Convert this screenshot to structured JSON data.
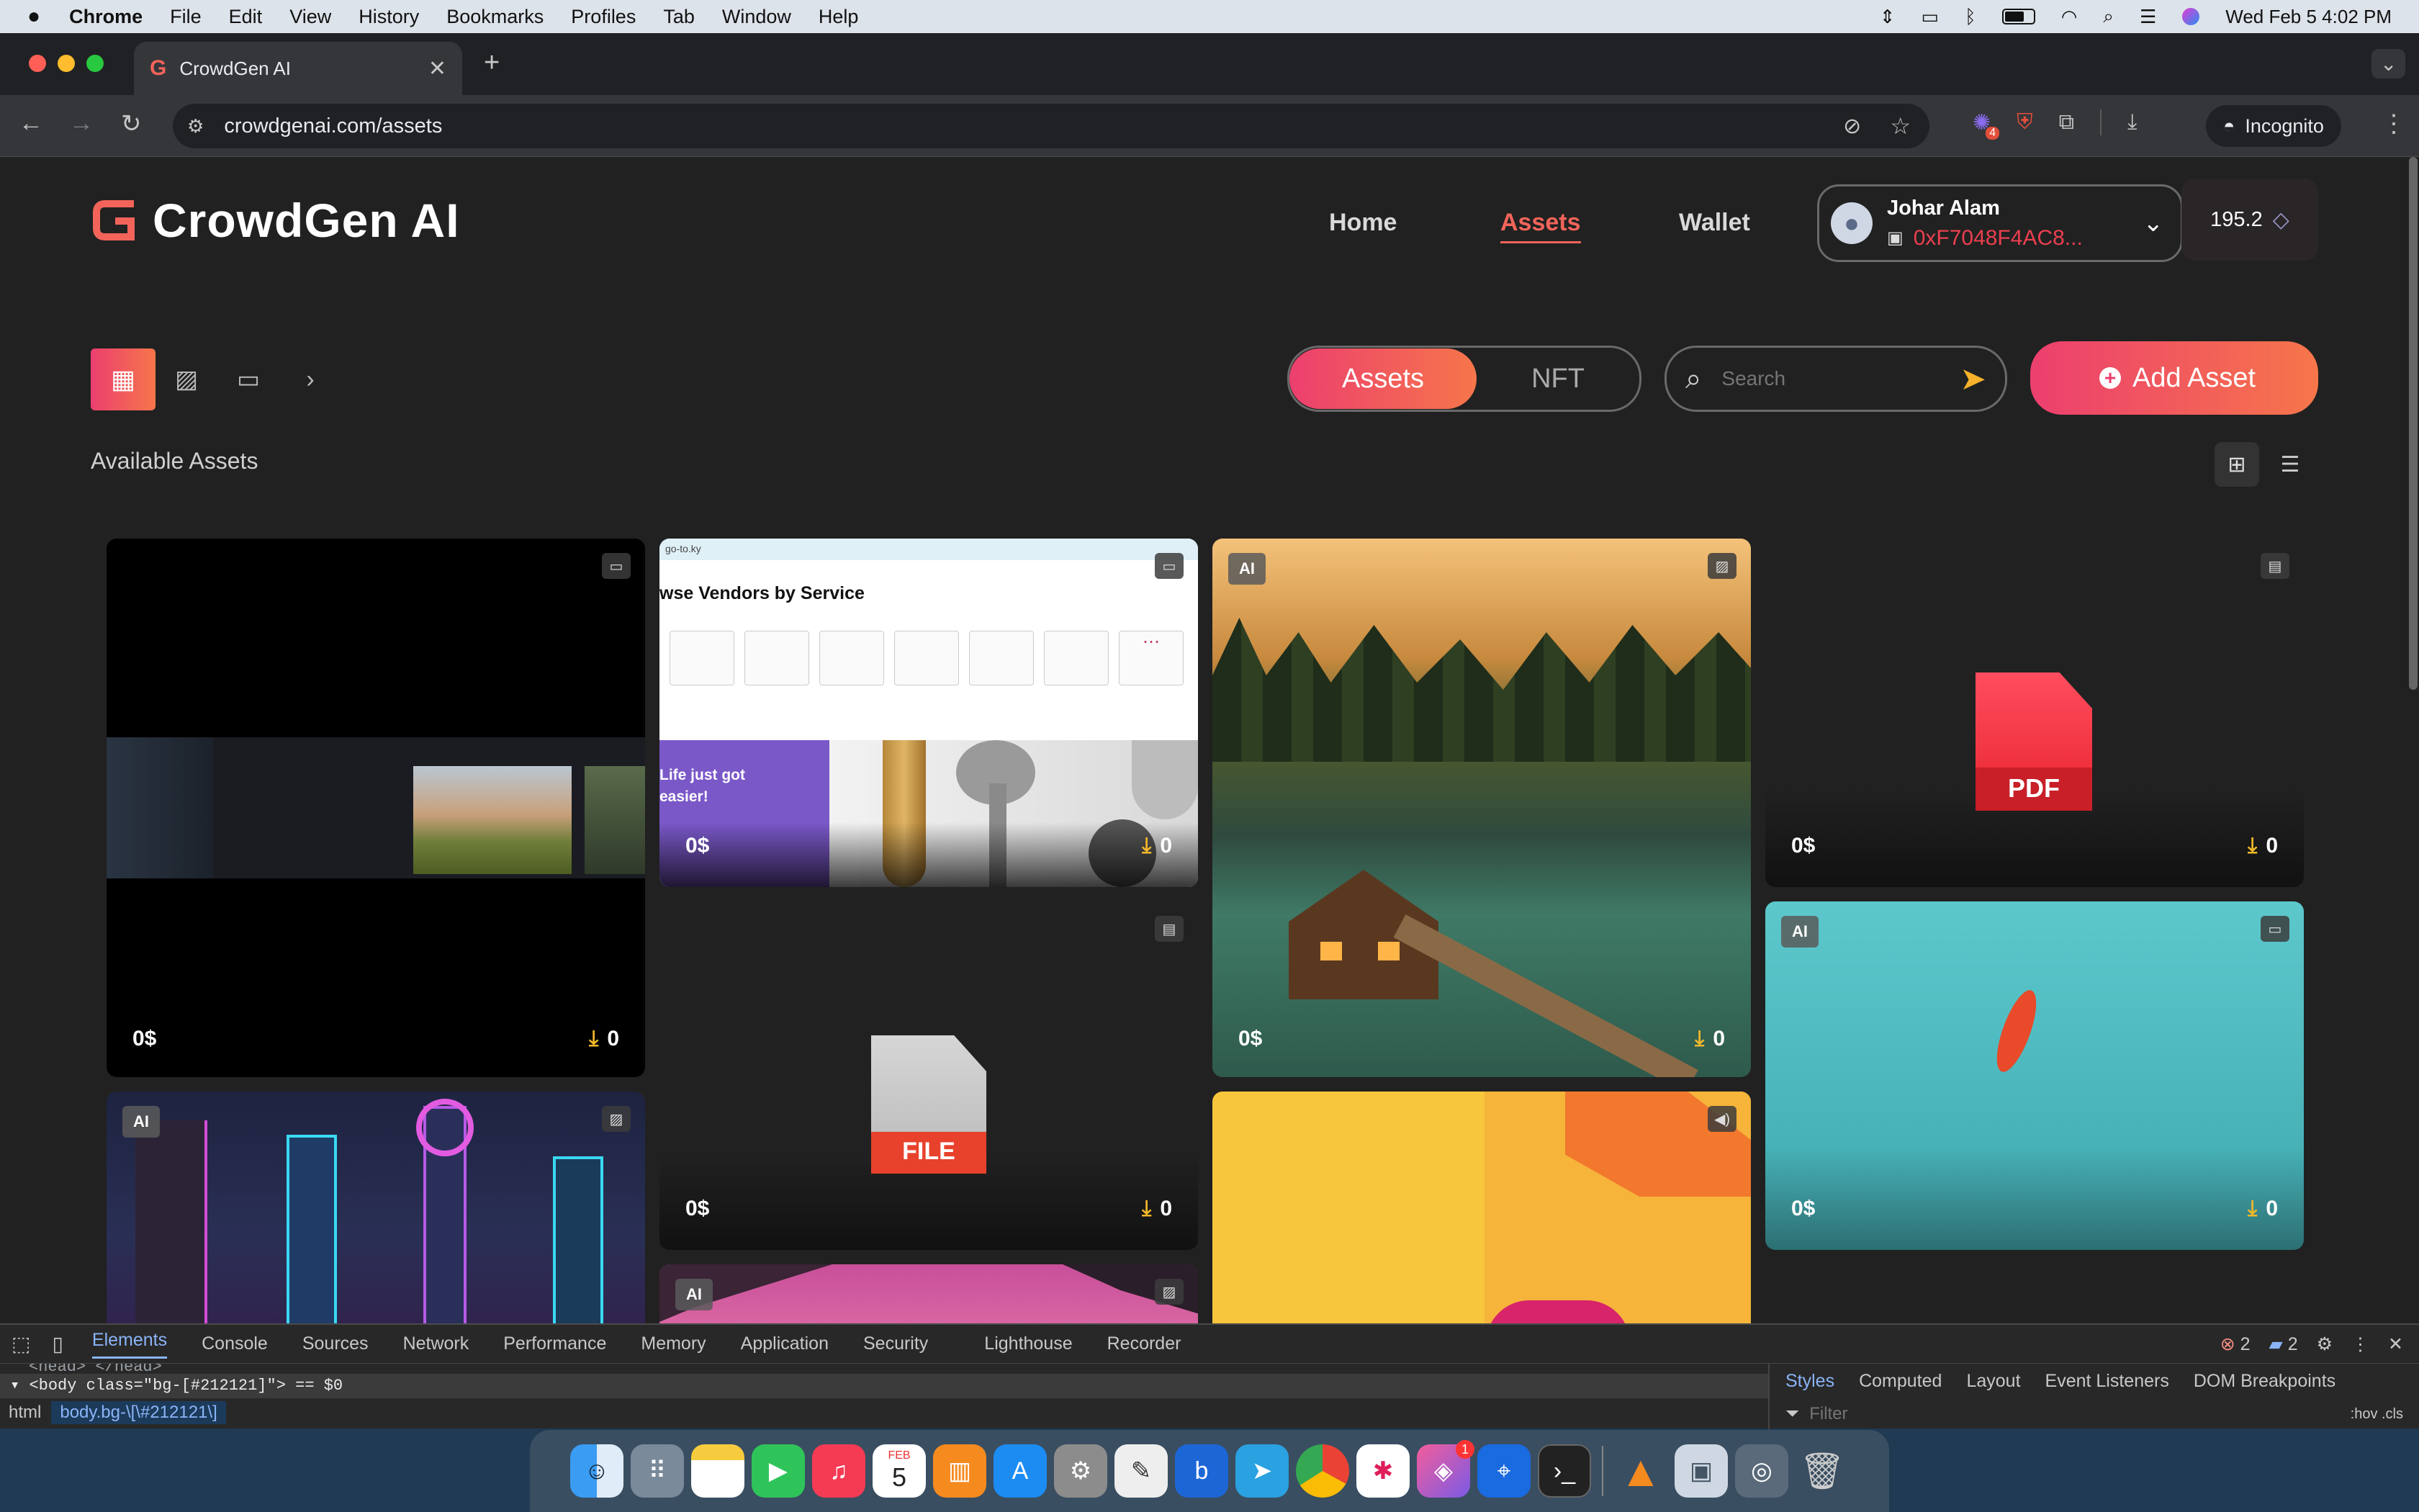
{
  "menubar": {
    "app": "Chrome",
    "items": [
      "File",
      "Edit",
      "View",
      "History",
      "Bookmarks",
      "Profiles",
      "Tab",
      "Window",
      "Help"
    ],
    "datetime": "Wed Feb 5  4:02 PM"
  },
  "browser": {
    "tab_title": "CrowdGen AI",
    "url": "crowdgenai.com/assets",
    "incognito_label": "Incognito",
    "extension_badge": "4"
  },
  "site": {
    "logo_text": "CrowdGen AI",
    "nav": [
      "Home",
      "Assets",
      "Wallet"
    ],
    "active_nav": "Assets",
    "user_name": "Johar Alam",
    "wallet_address": "0xF7048F4AC8...",
    "balance": "195.2"
  },
  "filters": {
    "toggle": [
      "Assets",
      "NFT"
    ],
    "search_placeholder": "Search",
    "add_label": "Add Asset",
    "section_title": "Available Assets"
  },
  "cards": [
    {
      "price": "0$",
      "downloads": "0",
      "type": "video",
      "ai": false
    },
    {
      "price": "0$",
      "downloads": "0",
      "type": "video",
      "ai": false,
      "heading": "wse Vendors by Service",
      "promo": "Life just got easier!",
      "mini_url": "go-to.ky"
    },
    {
      "price": "0$",
      "downloads": "0",
      "type": "image",
      "ai": true
    },
    {
      "price": "0$",
      "downloads": "0",
      "type": "document",
      "ai": false,
      "file_label": "PDF"
    },
    {
      "price": "0$",
      "downloads": "0",
      "type": "video",
      "ai": true
    },
    {
      "price": "0$",
      "downloads": "0",
      "type": "document",
      "ai": false,
      "file_label": "FILE"
    },
    {
      "price": "",
      "downloads": "",
      "type": "image",
      "ai": true
    },
    {
      "price": "",
      "downloads": "",
      "type": "image",
      "ai": true
    },
    {
      "price": "",
      "downloads": "",
      "type": "audio",
      "ai": false
    }
  ],
  "ai_badge": "AI",
  "devtools": {
    "tabs": [
      "Elements",
      "Console",
      "Sources",
      "Network",
      "Performance",
      "Memory",
      "Application",
      "Security",
      "Lighthouse",
      "Recorder"
    ],
    "errors": "2",
    "messages": "2",
    "dom_line": "<body class=\"bg-[#212121]\"> == $0",
    "head_line": "<head> </head>",
    "crumbs": [
      "html",
      "body.bg-\\[\\#212121\\]"
    ],
    "side_tabs": [
      "Styles",
      "Computed",
      "Layout",
      "Event Listeners",
      "DOM Breakpoints"
    ],
    "filter_placeholder": "Filter",
    "filter_tools": ":hov  .cls"
  },
  "dock": {
    "calendar_month": "FEB",
    "calendar_day": "5",
    "badge": "1"
  }
}
